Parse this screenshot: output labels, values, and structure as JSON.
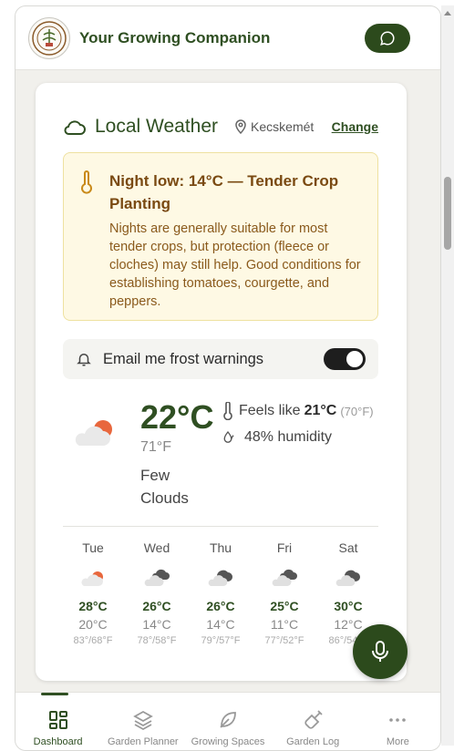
{
  "app": {
    "title": "Your Growing Companion"
  },
  "weather": {
    "title": "Local Weather",
    "location": "Kecskemét",
    "change_label": "Change",
    "alert": {
      "title": "Night low: 14°C — Tender Crop Planting",
      "text": "Nights are generally suitable for most tender crops, but protection (fleece or cloches) may still help. Good conditions for establishing tomatoes, courgette, and peppers."
    },
    "email_label": "Email me frost warnings",
    "email_enabled": true,
    "current": {
      "temp_c": "22°C",
      "temp_f": "71°F",
      "condition": "Few Clouds",
      "feels_label": "Feels like",
      "feels_c": "21°C",
      "feels_f": "(70°F)",
      "humidity": "48% humidity"
    },
    "forecast": [
      {
        "day": "Tue",
        "high": "28°C",
        "low": "20°C",
        "f": "83°/68°F",
        "icon": "sun-cloud-icon"
      },
      {
        "day": "Wed",
        "high": "26°C",
        "low": "14°C",
        "f": "78°/58°F",
        "icon": "broken-clouds-icon"
      },
      {
        "day": "Thu",
        "high": "26°C",
        "low": "14°C",
        "f": "79°/57°F",
        "icon": "dark-cloud-icon"
      },
      {
        "day": "Fri",
        "high": "25°C",
        "low": "11°C",
        "f": "77°/52°F",
        "icon": "broken-clouds-icon"
      },
      {
        "day": "Sat",
        "high": "30°C",
        "low": "12°C",
        "f": "86°/54°F",
        "icon": "dark-cloud-icon"
      }
    ]
  },
  "nav": {
    "items": [
      {
        "label": "Dashboard",
        "icon": "grid-icon",
        "active": true
      },
      {
        "label": "Garden Planner",
        "icon": "layers-icon",
        "active": false
      },
      {
        "label": "Growing Spaces",
        "icon": "leaf-icon",
        "active": false
      },
      {
        "label": "Garden Log",
        "icon": "trowel-icon",
        "active": false
      },
      {
        "label": "More",
        "icon": "more-icon",
        "active": false
      }
    ]
  },
  "colors": {
    "brand": "#2c4a1c",
    "alert_bg": "#fef9e4",
    "alert_text": "#7a4a12",
    "sun": "#e8673d"
  }
}
